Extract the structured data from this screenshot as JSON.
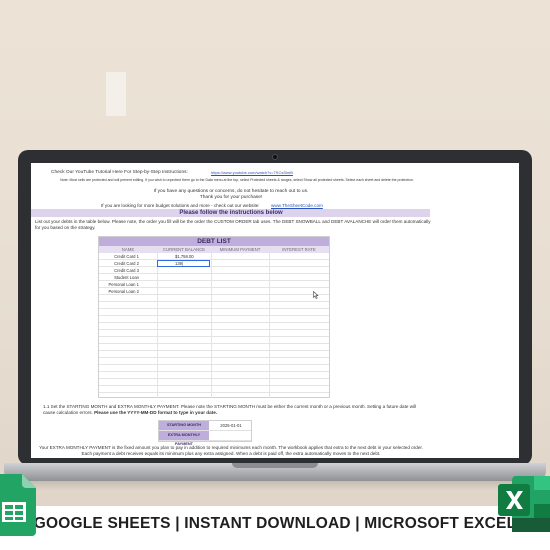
{
  "banner": {
    "text": "GOOGLE SHEETS | INSTANT DOWNLOAD | MICROSOFT EXCEL"
  },
  "icons": {
    "left": "google-sheets-icon",
    "right": "microsoft-excel-icon"
  },
  "sheet": {
    "tutorial_label": "Check Our YouTube Tutorial Here For Step-by-Step Instructions:",
    "tutorial_link": "https://www.youtube.com/watch?v=7SCsSlmB",
    "note": "Note: Most cells are protected and will prevent editing. If you wish to unprotect them go to the Data menu at the top, select Protected sheets & ranges, select Show all protected sheets. Select each sheet and delete the protection.",
    "questions": "If you have any questions or concerns, do not hesitate to reach out to us.",
    "thanks": "Thank you for your purchase!",
    "more_label": "If you are looking for more budget solutions and more - check out our website:",
    "more_link": "www.TheSheetCode.com",
    "instructions_header": "Please follow the instructions below",
    "list_instructions": "List out your debts in the table below. Please note, the order you fill will be the order the CUSTOM ORDER tab uses. The DEBT SNOWBALL and DEBT AVALANCHE will order them automatically for you based on the strategy.",
    "debt_list": {
      "title": "DEBT LIST",
      "headers": [
        "NAME",
        "CURRENT BALANCE",
        "MINIMUM PAYMENT",
        "INTEREST RATE"
      ],
      "rows": [
        {
          "name": "Credit Card 1",
          "balance": "$1,758.00"
        },
        {
          "name": "Credit Card 2",
          "balance": "139|"
        },
        {
          "name": "Credit Card 3",
          "balance": ""
        },
        {
          "name": "Student Loan",
          "balance": ""
        },
        {
          "name": "Personal Loan 1",
          "balance": ""
        },
        {
          "name": "Personal Loan 2",
          "balance": ""
        }
      ]
    },
    "step_text": "1.1 Set the STARTING MONTH and EXTRA MONTHLY PAYMENT. Please note the STARTING MONTH must be either the current month or a previous month. Setting a future date will cause calculation errors.",
    "step_bold": "Please use the YYYY-MM-DD format to type in your date.",
    "starting_month_label": "STARTING MONTH",
    "starting_month_value": "2025-01-01",
    "extra_payment_label": "EXTRA MONTHLY PAYMENT",
    "extra_payment_value": "",
    "extra_text_1": "Your EXTRA MONTHLY PAYMENT is the fixed amount you plan to pay in addition to required minimums each month. The workbook applies that extra to the next debt in your selected order.",
    "extra_text_2": "Each payment a debt receives equals its minimum plus any extra assigned. When a debt is paid off, the extra automatically moves to the next debt."
  },
  "colors": {
    "purple_header": "#bfaedb",
    "purple_bar": "#ddd3ec",
    "link": "#2a55b8",
    "selection": "#2f6be0"
  }
}
